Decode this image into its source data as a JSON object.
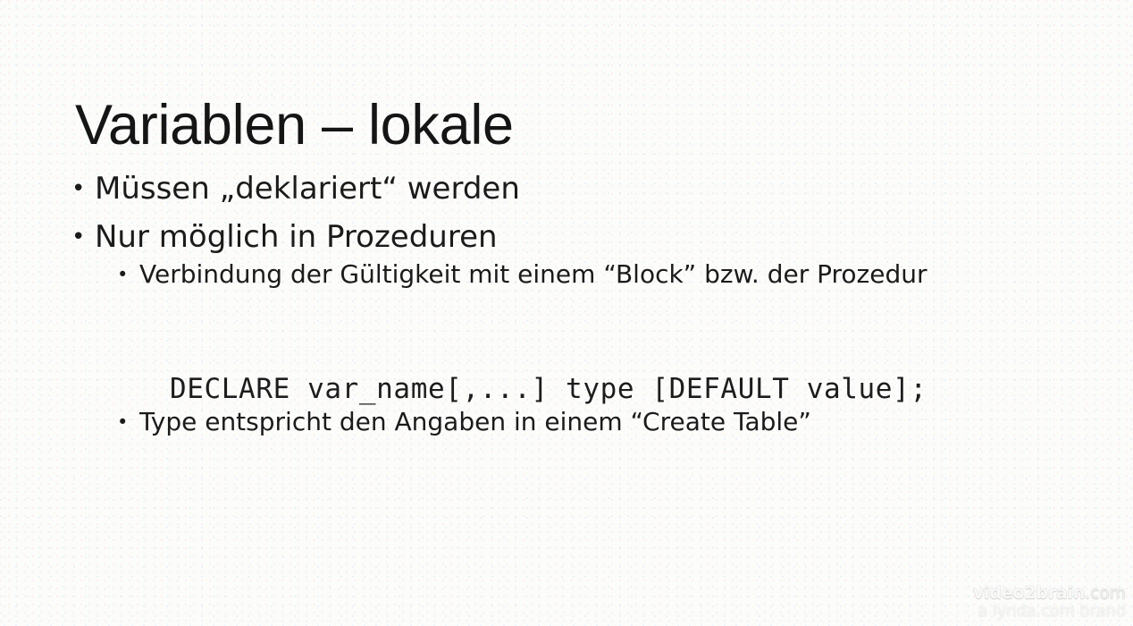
{
  "slide": {
    "title": "Variablen – lokale",
    "background_color": "#fcfcfa",
    "text_color": "#1b1b1b",
    "bullets": [
      {
        "level": 1,
        "marker": "•",
        "text": "Müssen „deklariert“ werden"
      },
      {
        "level": 1,
        "marker": "•",
        "text": "Nur möglich in Prozeduren"
      },
      {
        "level": 2,
        "marker": "•",
        "text": "Verbindung der Gültigkeit mit einem “Block” bzw. der Prozedur"
      },
      {
        "level": 2,
        "marker": "•",
        "text": "Type entspricht den Angaben in einem “Create Table”"
      }
    ],
    "code": "DECLARE var_name[,...] type [DEFAULT value];"
  },
  "watermark": {
    "brand": "video2brain",
    "brand_tld": ".com",
    "tagline": "a lynda.com brand"
  }
}
